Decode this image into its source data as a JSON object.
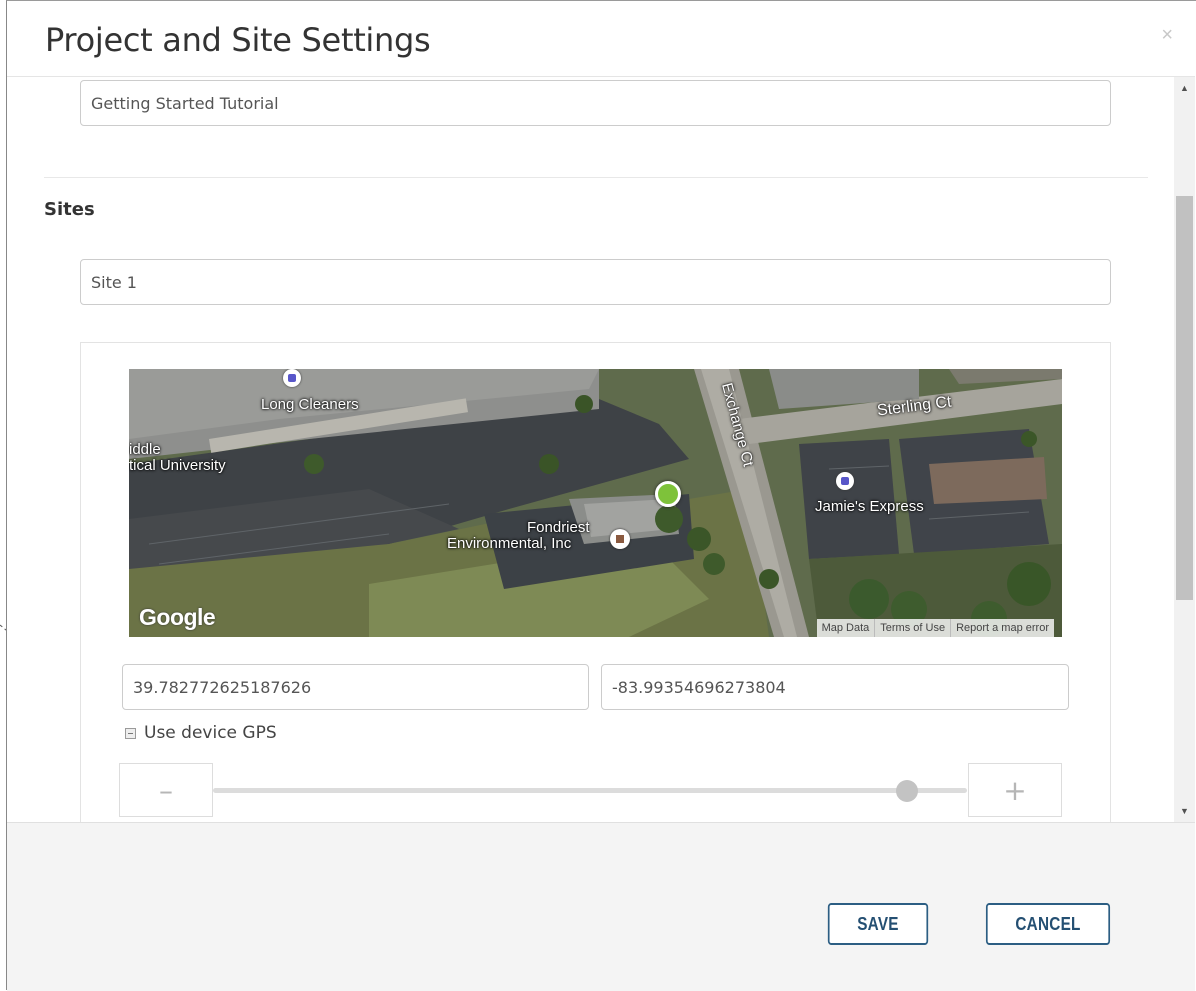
{
  "modal": {
    "title": "Project and Site Settings",
    "close_label": "×"
  },
  "project": {
    "name_value": "Getting Started Tutorial"
  },
  "sites": {
    "section_title": "Sites",
    "site_name_value": "Site 1",
    "map": {
      "logo": "Google",
      "footer_links": {
        "map_data": "Map Data",
        "terms": "Terms of Use",
        "report": "Report a map error"
      },
      "labels": {
        "long_cleaners": "Long Cleaners",
        "university_line1": "iddle",
        "university_line2": "tical University",
        "exchange_ct": "Exchange Ct",
        "sterling_ct": "Sterling Ct",
        "jamies_express": "Jamie's Express",
        "fondriest_line1": "Fondriest",
        "fondriest_line2": "Environmental, Inc"
      },
      "marker_color": "#7ec23a"
    },
    "latitude_value": "39.782772625187626",
    "longitude_value": "-83.99354696273804",
    "use_gps_label": "Use device GPS",
    "use_gps_checked": false,
    "zoom": {
      "decrease_label": "–",
      "increase_label": "+",
      "level_fraction": 0.92
    }
  },
  "footer": {
    "save_label": "SAVE",
    "cancel_label": "CANCEL"
  },
  "colors": {
    "button_border": "#2c5e83",
    "footer_bg": "#f4f4f4"
  }
}
